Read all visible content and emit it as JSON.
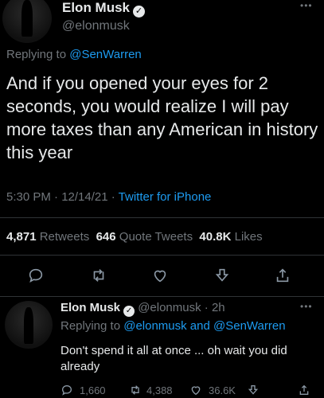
{
  "main_tweet": {
    "author_name": "Elon Musk",
    "author_handle": "@elonmusk",
    "replying_prefix": "Replying to",
    "replying_to": "@SenWarren",
    "text": "And if you opened your eyes for 2 seconds, you would realize I will pay more taxes than any American in history this year",
    "time": "5:30 PM · 12/14/21 ·",
    "source": "Twitter for iPhone",
    "retweets_count": "4,871",
    "retweets_label": "Retweets",
    "quotes_count": "646",
    "quotes_label": "Quote Tweets",
    "likes_count": "40.8K",
    "likes_label": "Likes",
    "more_icon": "more-dots-icon"
  },
  "action_bar": {
    "icons": [
      "reply-icon",
      "retweet-icon",
      "like-icon",
      "bookmark-icon",
      "share-icon"
    ]
  },
  "reply_tweet": {
    "author_name": "Elon Musk",
    "author_handle": "@elonmusk · 2h",
    "replying_prefix": "Replying to",
    "replying_to": "@elonmusk and @SenWarren",
    "text": "Don't spend it all at once ... oh wait you did already",
    "reply_count": "1,660",
    "retweet_count": "4,388",
    "like_count": "36.6K"
  },
  "colors": {
    "background": "#000000",
    "text": "#e7e9ea",
    "muted": "#71767b",
    "link": "#1d9bf0",
    "divider": "#2f3336"
  }
}
